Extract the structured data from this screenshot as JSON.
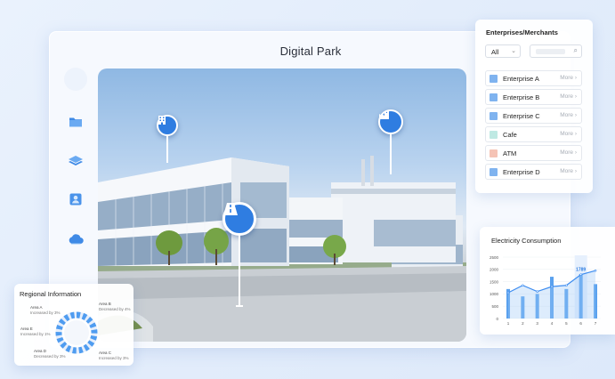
{
  "app": {
    "title": "Digital Park"
  },
  "colors": {
    "accent": "#2f7de1",
    "bar": "#5aa1ee",
    "line": "#3c8cf0",
    "ring": "#4f9cf0"
  },
  "rail": [
    {
      "icon": "folder-icon"
    },
    {
      "icon": "layers-icon"
    },
    {
      "icon": "contacts-icon"
    },
    {
      "icon": "cloud-icon"
    }
  ],
  "pins": [
    {
      "icon": "office-building-icon"
    },
    {
      "icon": "factory-icon"
    },
    {
      "icon": "road-icon"
    }
  ],
  "enterprises": {
    "title": "Enterprises/Merchants",
    "filter_value": "All",
    "more_label": "More",
    "items": [
      {
        "name": "Enterprise A",
        "color": "#7fb3ef"
      },
      {
        "name": "Enterprise B",
        "color": "#7fb3ef"
      },
      {
        "name": "Enterprise C",
        "color": "#7fb3ef"
      },
      {
        "name": "Cafe",
        "color": "#bfe9e3"
      },
      {
        "name": "ATM",
        "color": "#f5c3b5"
      },
      {
        "name": "Enterprise D",
        "color": "#7fb3ef"
      }
    ]
  },
  "electricity": {
    "title": "Electricity Consumption",
    "chart_data": {
      "type": "bar",
      "x": [
        "1",
        "2",
        "3",
        "4",
        "5",
        "6",
        "7"
      ],
      "y_ticks": [
        "0",
        "500",
        "1000",
        "1500",
        "2000",
        "2500"
      ],
      "ylim": [
        0,
        2500
      ],
      "bar_values": [
        1200,
        900,
        1000,
        1700,
        1200,
        1800,
        1400
      ],
      "line_values": [
        1050,
        1350,
        1100,
        1300,
        1350,
        1789,
        1950
      ],
      "highlight_label": "1789"
    }
  },
  "regional": {
    "title": "Regional Information",
    "areas": [
      {
        "name": "Area A",
        "change": "Increased by 3%"
      },
      {
        "name": "Area B",
        "change": "Decreased by 4%"
      },
      {
        "name": "Area E",
        "change": "Increased by 1%"
      },
      {
        "name": "Area D",
        "change": "Decreased by 3%"
      },
      {
        "name": "Area C",
        "change": "Increased by 3%"
      }
    ]
  }
}
